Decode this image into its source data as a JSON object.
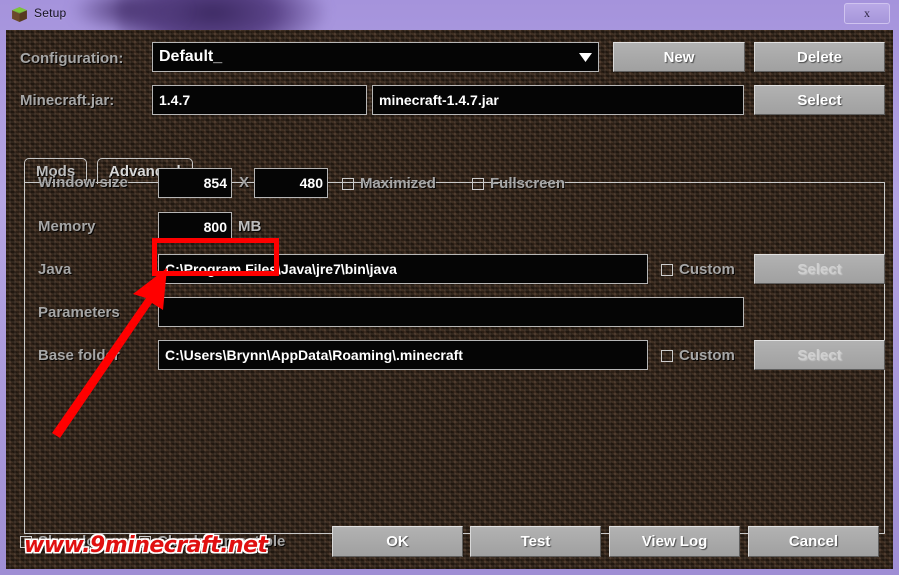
{
  "window": {
    "title": "Setup",
    "icon": "grass-block-icon",
    "close_label": "x",
    "titlebar_color": "#b0a0e0",
    "panel_color": "#3a2a1e"
  },
  "config_row": {
    "label": "Configuration:",
    "value": "Default_",
    "new_label": "New",
    "delete_label": "Delete"
  },
  "jar_row": {
    "label": "Minecraft.jar:",
    "version": "1.4.7",
    "filename": "minecraft-1.4.7.jar",
    "select_label": "Select"
  },
  "tabs": [
    {
      "label": "Mods",
      "active": false
    },
    {
      "label": "Advanced",
      "active": true
    }
  ],
  "advanced": {
    "window_size": {
      "label": "Window size",
      "width": "854",
      "separator": "X",
      "height": "480",
      "maximized_label": "Maximized",
      "maximized_checked": false,
      "fullscreen_label": "Fullscreen",
      "fullscreen_checked": false
    },
    "memory": {
      "label": "Memory",
      "value": "800",
      "unit": "MB",
      "highlight_color": "#ff0000"
    },
    "java": {
      "label": "Java",
      "value": "C:\\Program Files\\Java\\jre7\\bin\\java",
      "custom_label": "Custom",
      "custom_checked": false,
      "select_label": "Select"
    },
    "parameters": {
      "label": "Parameters",
      "value": "",
      "placeholder": ""
    },
    "base_folder": {
      "label": "Base folder",
      "value": "C:\\Users\\Brynn\\AppData\\Roaming\\.minecraft",
      "custom_label": "Custom",
      "custom_checked": false,
      "select_label": "Select"
    }
  },
  "footer": {
    "show_log_label": "Show log",
    "show_log_checked": false,
    "check_compatible_label": "Check compatible",
    "check_compatible_checked": true,
    "buttons": [
      {
        "label": "OK"
      },
      {
        "label": "Test"
      },
      {
        "label": "View Log"
      },
      {
        "label": "Cancel"
      }
    ]
  },
  "annotation": {
    "arrow_color": "#ff0000",
    "watermark": "www.9minecraft.net"
  }
}
